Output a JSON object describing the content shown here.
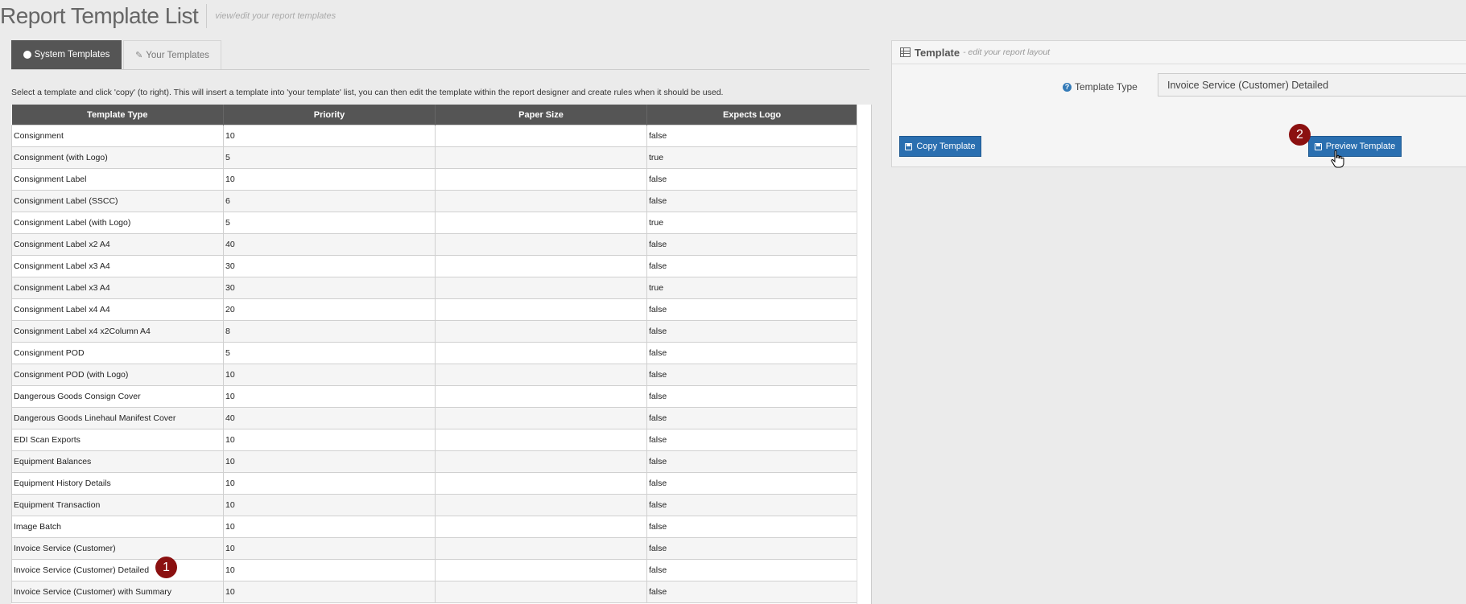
{
  "header": {
    "title": "Report Template List",
    "subtitle": "view/edit your report templates"
  },
  "tabs": {
    "system": "System Templates",
    "yours": "Your Templates"
  },
  "instruction": "Select a template and click 'copy' (to right). This will insert a template into 'your template' list, you can then edit the template within the report designer and create rules when it should be used.",
  "table": {
    "columns": [
      "Template Type",
      "Priority",
      "Paper Size",
      "Expects Logo"
    ],
    "rows": [
      {
        "type": "Consignment",
        "priority": "10",
        "paper": "",
        "logo": "false"
      },
      {
        "type": "Consignment (with Logo)",
        "priority": "5",
        "paper": "",
        "logo": "true"
      },
      {
        "type": "Consignment Label",
        "priority": "10",
        "paper": "",
        "logo": "false"
      },
      {
        "type": "Consignment Label (SSCC)",
        "priority": "6",
        "paper": "",
        "logo": "false"
      },
      {
        "type": "Consignment Label (with Logo)",
        "priority": "5",
        "paper": "",
        "logo": "true"
      },
      {
        "type": "Consignment Label x2 A4",
        "priority": "40",
        "paper": "",
        "logo": "false"
      },
      {
        "type": "Consignment Label x3 A4",
        "priority": "30",
        "paper": "",
        "logo": "false"
      },
      {
        "type": "Consignment Label x3 A4",
        "priority": "30",
        "paper": "",
        "logo": "true"
      },
      {
        "type": "Consignment Label x4 A4",
        "priority": "20",
        "paper": "",
        "logo": "false"
      },
      {
        "type": "Consignment Label x4 x2Column A4",
        "priority": "8",
        "paper": "",
        "logo": "false"
      },
      {
        "type": "Consignment POD",
        "priority": "5",
        "paper": "",
        "logo": "false"
      },
      {
        "type": "Consignment POD (with Logo)",
        "priority": "10",
        "paper": "",
        "logo": "false"
      },
      {
        "type": "Dangerous Goods Consign Cover",
        "priority": "10",
        "paper": "",
        "logo": "false"
      },
      {
        "type": "Dangerous Goods Linehaul Manifest Cover",
        "priority": "40",
        "paper": "",
        "logo": "false"
      },
      {
        "type": "EDI Scan Exports",
        "priority": "10",
        "paper": "",
        "logo": "false"
      },
      {
        "type": "Equipment Balances",
        "priority": "10",
        "paper": "",
        "logo": "false"
      },
      {
        "type": "Equipment History Details",
        "priority": "10",
        "paper": "",
        "logo": "false"
      },
      {
        "type": "Equipment Transaction",
        "priority": "10",
        "paper": "",
        "logo": "false"
      },
      {
        "type": "Image Batch",
        "priority": "10",
        "paper": "",
        "logo": "false"
      },
      {
        "type": "Invoice Service (Customer)",
        "priority": "10",
        "paper": "",
        "logo": "false"
      },
      {
        "type": "Invoice Service (Customer) Detailed",
        "priority": "10",
        "paper": "",
        "logo": "false"
      },
      {
        "type": "Invoice Service (Customer) with Summary",
        "priority": "10",
        "paper": "",
        "logo": "false"
      }
    ]
  },
  "panel": {
    "title": "Template",
    "subtitle": "- edit your report layout",
    "template_type_label": "Template Type",
    "template_type_value": "Invoice Service (Customer) Detailed",
    "copy_label": "Copy Template",
    "preview_label": "Preview Template"
  },
  "markers": {
    "one": "1",
    "two": "2"
  },
  "colors": {
    "header_bg": "#555555",
    "button_bg": "#2a6fb0",
    "marker_bg": "#8b1010"
  },
  "icons": [
    "circle-icon",
    "pencil-icon",
    "table-icon",
    "help-icon",
    "save-icon",
    "hand-cursor-icon"
  ]
}
